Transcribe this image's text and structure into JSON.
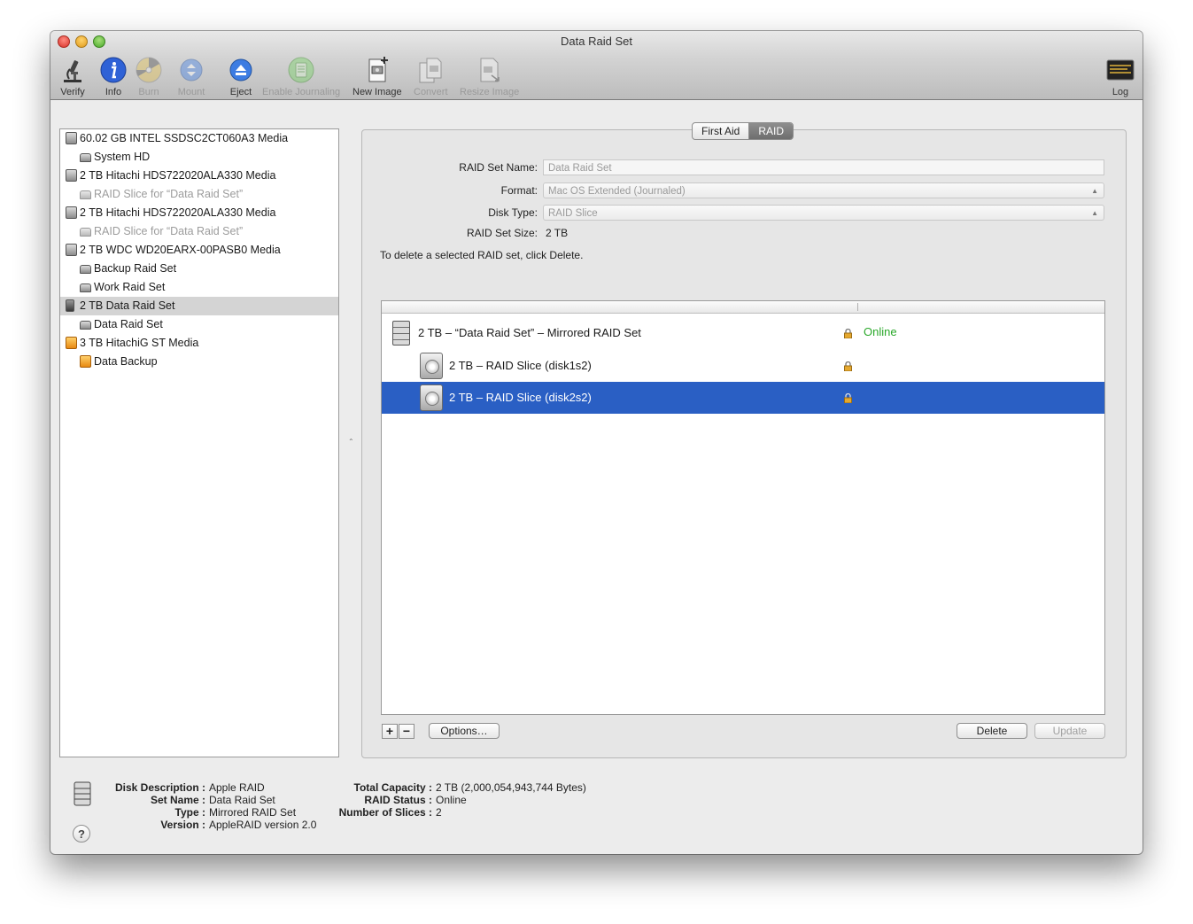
{
  "window": {
    "title": "Data Raid Set"
  },
  "toolbar": {
    "verify": "Verify",
    "info": "Info",
    "burn": "Burn",
    "mount": "Mount",
    "eject": "Eject",
    "enable_journaling": "Enable Journaling",
    "new_image": "New Image",
    "convert": "Convert",
    "resize_image": "Resize Image",
    "log": "Log"
  },
  "sidebar": {
    "items": [
      {
        "label": "60.02 GB INTEL SSDSC2CT060A3 Media",
        "icon": "internal-disk-icon"
      },
      {
        "label": "System HD",
        "icon": "volume-icon"
      },
      {
        "label": "2 TB Hitachi HDS722020ALA330 Media",
        "icon": "internal-disk-icon"
      },
      {
        "label": "RAID Slice for “Data Raid Set”",
        "icon": "volume-icon"
      },
      {
        "label": "2 TB Hitachi HDS722020ALA330 Media",
        "icon": "internal-disk-icon"
      },
      {
        "label": "RAID Slice for “Data Raid Set”",
        "icon": "volume-icon"
      },
      {
        "label": "2 TB WDC WD20EARX-00PASB0 Media",
        "icon": "internal-disk-icon"
      },
      {
        "label": "Backup Raid Set",
        "icon": "volume-icon"
      },
      {
        "label": "Work Raid Set",
        "icon": "volume-icon"
      },
      {
        "label": "2 TB Data Raid Set",
        "icon": "raid-disk-icon"
      },
      {
        "label": "Data Raid Set",
        "icon": "volume-icon"
      },
      {
        "label": "3 TB HitachiG ST Media",
        "icon": "external-disk-icon"
      },
      {
        "label": "Data Backup",
        "icon": "external-volume-icon"
      }
    ]
  },
  "tabs": {
    "first_aid": "First Aid",
    "raid": "RAID"
  },
  "form": {
    "name_label": "RAID Set Name:",
    "name_value": "Data Raid Set",
    "format_label": "Format:",
    "format_value": "Mac OS Extended (Journaled)",
    "disk_type_label": "Disk Type:",
    "disk_type_value": "RAID Slice",
    "size_label": "RAID Set Size:",
    "size_value": "2 TB",
    "hint": "To delete a selected RAID set, click Delete."
  },
  "raid_list": {
    "set_label": "2 TB – “Data Raid Set” – Mirrored RAID Set",
    "set_status": "Online",
    "slices": [
      "2 TB – RAID Slice (disk1s2)",
      "2 TB – RAID Slice (disk2s2)"
    ]
  },
  "buttons": {
    "add": "+",
    "remove": "−",
    "options": "Options…",
    "delete": "Delete",
    "update": "Update"
  },
  "footer": {
    "disk_description_key": "Disk Description :",
    "disk_description": "Apple RAID",
    "set_name_key": "Set Name :",
    "set_name": "Data Raid Set",
    "type_key": "Type :",
    "type": "Mirrored RAID Set",
    "version_key": "Version :",
    "version": "AppleRAID version 2.0",
    "total_capacity_key": "Total Capacity :",
    "total_capacity": "2 TB (2,000,054,943,744 Bytes)",
    "raid_status_key": "RAID Status :",
    "raid_status": "Online",
    "number_of_slices_key": "Number of Slices :",
    "number_of_slices": "2",
    "help": "?"
  },
  "colors": {
    "selection": "#2a5fc4",
    "online": "#2aa82a",
    "info_blue": "#2f62d6"
  }
}
